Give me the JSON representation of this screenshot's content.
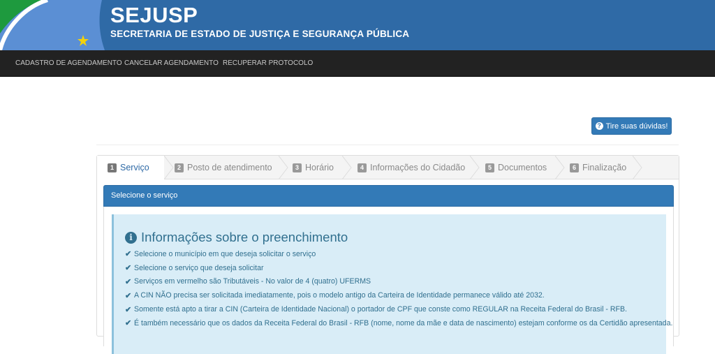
{
  "header": {
    "title": "SEJUSP",
    "subtitle": "SECRETARIA DE ESTADO DE JUSTIÇA E SEGURANÇA PÚBLICA",
    "colors": {
      "banner": "#2f6aa6",
      "green": "#1e9a3e",
      "star": "#f5d20a"
    }
  },
  "nav": {
    "items": [
      {
        "label": "CADASTRO DE AGENDAMENTO"
      },
      {
        "label": "CANCELAR AGENDAMENTO"
      },
      {
        "label": "RECUPERAR PROTOCOLO"
      }
    ]
  },
  "help_button": {
    "icon": "question-circle-icon",
    "label": "Tire suas dúvidas!"
  },
  "wizard": {
    "steps": [
      {
        "num": "1",
        "label": "Serviço",
        "active": true
      },
      {
        "num": "2",
        "label": "Posto de atendimento",
        "active": false
      },
      {
        "num": "3",
        "label": "Horário",
        "active": false
      },
      {
        "num": "4",
        "label": "Informações do Cidadão",
        "active": false
      },
      {
        "num": "5",
        "label": "Documentos",
        "active": false
      },
      {
        "num": "6",
        "label": "Finalização",
        "active": false
      }
    ],
    "panel_title": "Selecione o serviço"
  },
  "info": {
    "icon": "info-circle-icon",
    "title": "Informações sobre o preenchimento",
    "items": [
      "Selecione o município em que deseja solicitar o serviço",
      "Selecione o serviço que deseja solicitar",
      "Serviços em vermelho são Tributáveis - No valor de 4 (quatro) UFERMS",
      "A CIN NÃO precisa ser solicitada imediatamente, pois o modelo antigo da Carteira de Identidade permanece válido até 2032.",
      "Somente está apto a tirar a CIN (Carteira de Identidade Nacional) o portador de CPF que conste como REGULAR na Receita Federal do Brasil - RFB.",
      "É também necessário que os dados da Receita Federal do Brasil - RFB (nome, nome da mãe e data de nascimento) estejam conforme os da Certidão apresentada."
    ]
  }
}
